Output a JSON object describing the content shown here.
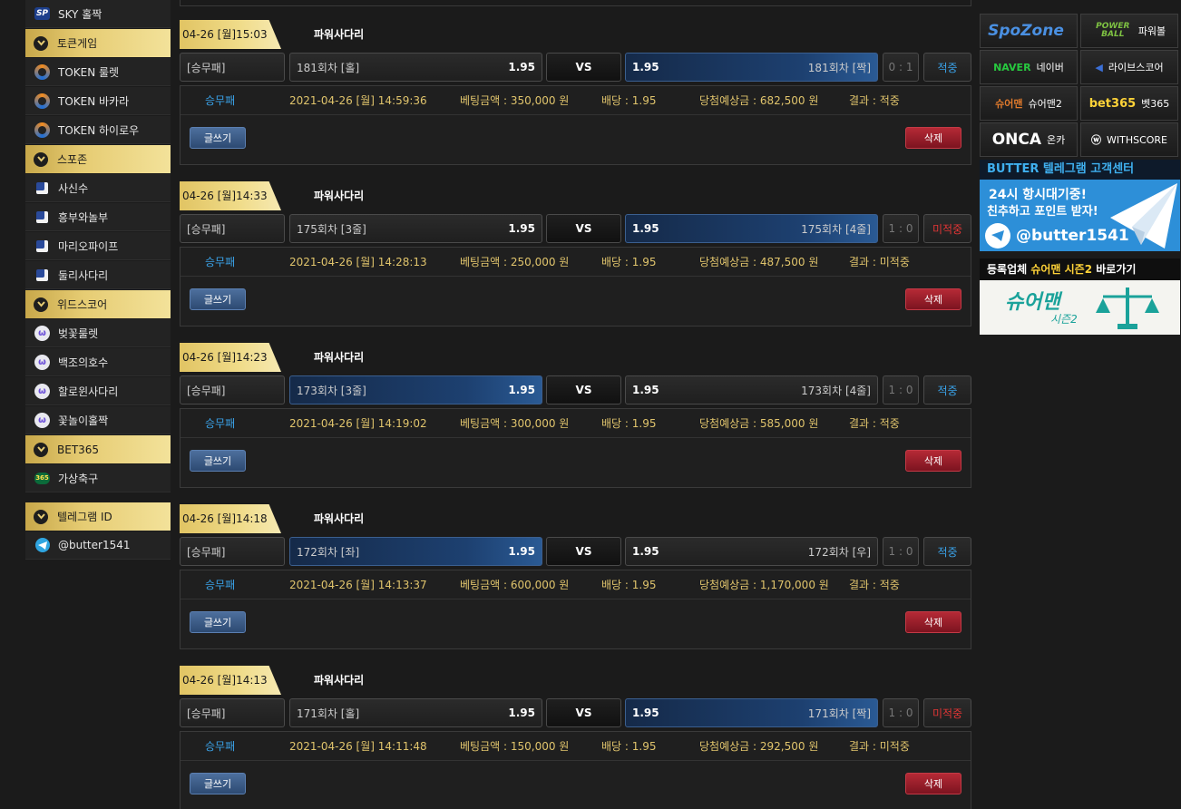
{
  "sidebar": {
    "items": [
      {
        "kind": "item",
        "icon": "sp-icon",
        "label": "SKY 홀짝"
      },
      {
        "kind": "head",
        "label": "토큰게임"
      },
      {
        "kind": "item",
        "icon": "token-icon",
        "label": "TOKEN 룰렛"
      },
      {
        "kind": "item",
        "icon": "token-icon",
        "label": "TOKEN 바카라"
      },
      {
        "kind": "item",
        "icon": "token-icon",
        "label": "TOKEN 하이로우"
      },
      {
        "kind": "head",
        "label": "스포존"
      },
      {
        "kind": "item",
        "icon": "spozone-icon",
        "label": "사신수"
      },
      {
        "kind": "item",
        "icon": "spozone-icon",
        "label": "흥부와놀부"
      },
      {
        "kind": "item",
        "icon": "spozone-icon",
        "label": "마리오파이프"
      },
      {
        "kind": "item",
        "icon": "spozone-icon",
        "label": "둘리사다리"
      },
      {
        "kind": "head",
        "label": "위드스코어"
      },
      {
        "kind": "item",
        "icon": "withscore-icon",
        "label": "벚꽃룰렛"
      },
      {
        "kind": "item",
        "icon": "withscore-icon",
        "label": "백조의호수"
      },
      {
        "kind": "item",
        "icon": "withscore-icon",
        "label": "할로윈사다리"
      },
      {
        "kind": "item",
        "icon": "withscore-icon",
        "label": "꽃놀이홀짝"
      },
      {
        "kind": "head",
        "label": "BET365"
      },
      {
        "kind": "item",
        "icon": "bet365-icon",
        "label": "가상축구"
      },
      {
        "kind": "gap"
      },
      {
        "kind": "head",
        "label": "텔레그램 ID"
      },
      {
        "kind": "item",
        "icon": "telegram-icon",
        "label": "@butter1541"
      }
    ]
  },
  "labels": {
    "vs": "VS",
    "write": "글쓰기",
    "delete": "삭제",
    "amount_prefix": "베팅금액 : ",
    "odds_prefix": "배당 : ",
    "win_prefix": "당첨예상금 : ",
    "result_prefix": "결과 : "
  },
  "bets": [
    {
      "date": "04-26 [월]15:03",
      "game": "파워사다리",
      "type": "[승무패]",
      "home": "181회차 [홀]",
      "home_odds": "1.95",
      "away": "181회차 [짝]",
      "away_odds": "1.95",
      "selected": "away",
      "score": "0 : 1",
      "result": "적중",
      "win": true,
      "d_type": "승무패",
      "time": "2021-04-26 [월] 14:59:36",
      "amount": "350,000 원",
      "odds": "1.95",
      "payout": "682,500 원"
    },
    {
      "date": "04-26 [월]14:33",
      "game": "파워사다리",
      "type": "[승무패]",
      "home": "175회차 [3줄]",
      "home_odds": "1.95",
      "away": "175회차 [4줄]",
      "away_odds": "1.95",
      "selected": "away",
      "score": "1 : 0",
      "result": "미적중",
      "win": false,
      "d_type": "승무패",
      "time": "2021-04-26 [월] 14:28:13",
      "amount": "250,000 원",
      "odds": "1.95",
      "payout": "487,500 원"
    },
    {
      "date": "04-26 [월]14:23",
      "game": "파워사다리",
      "type": "[승무패]",
      "home": "173회차 [3줄]",
      "home_odds": "1.95",
      "away": "173회차 [4줄]",
      "away_odds": "1.95",
      "selected": "home",
      "score": "1 : 0",
      "result": "적중",
      "win": true,
      "d_type": "승무패",
      "time": "2021-04-26 [월] 14:19:02",
      "amount": "300,000 원",
      "odds": "1.95",
      "payout": "585,000 원"
    },
    {
      "date": "04-26 [월]14:18",
      "game": "파워사다리",
      "type": "[승무패]",
      "home": "172회차 [좌]",
      "home_odds": "1.95",
      "away": "172회차 [우]",
      "away_odds": "1.95",
      "selected": "home",
      "score": "1 : 0",
      "result": "적중",
      "win": true,
      "d_type": "승무패",
      "time": "2021-04-26 [월] 14:13:37",
      "amount": "600,000 원",
      "odds": "1.95",
      "payout": "1,170,000 원"
    },
    {
      "date": "04-26 [월]14:13",
      "game": "파워사다리",
      "type": "[승무패]",
      "home": "171회차 [홀]",
      "home_odds": "1.95",
      "away": "171회차 [짝]",
      "away_odds": "1.95",
      "selected": "away",
      "score": "1 : 0",
      "result": "미적중",
      "win": false,
      "d_type": "승무패",
      "time": "2021-04-26 [월] 14:11:48",
      "amount": "150,000 원",
      "odds": "1.95",
      "payout": "292,500 원"
    }
  ],
  "links": [
    {
      "mark": "SpoZone",
      "label": "",
      "color": "#4a90e2"
    },
    {
      "mark": "POWER BALL",
      "label": "파워볼",
      "color": "#7ec242"
    },
    {
      "mark": "NAVER",
      "label": "네이버",
      "color": "#27c93f"
    },
    {
      "mark": "◀",
      "label": "라이브스코어",
      "color": "#3b6fd6"
    },
    {
      "mark": "슈어맨",
      "label": "슈어맨2",
      "color": "#e07a2c"
    },
    {
      "mark": "bet365",
      "label": "벳365",
      "color": "#ffd338"
    },
    {
      "mark": "ONCA",
      "label": "온카",
      "color": "#ffffff"
    },
    {
      "mark": "ⓦ",
      "label": "WITHSCORE",
      "color": "#ffffff"
    }
  ],
  "banner_telegram": {
    "strip": "BUTTER 텔레그램 고객센터",
    "line1": "24시 항시대기중!",
    "line2": "친추하고 포인트 받자!",
    "handle": "@butter1541"
  },
  "banner_sureman": {
    "strip_a": "등록업체 ",
    "strip_b": "슈어맨 시즌2",
    "strip_c": " 바로가기",
    "logo": "슈어맨",
    "sub": "시즌2"
  }
}
